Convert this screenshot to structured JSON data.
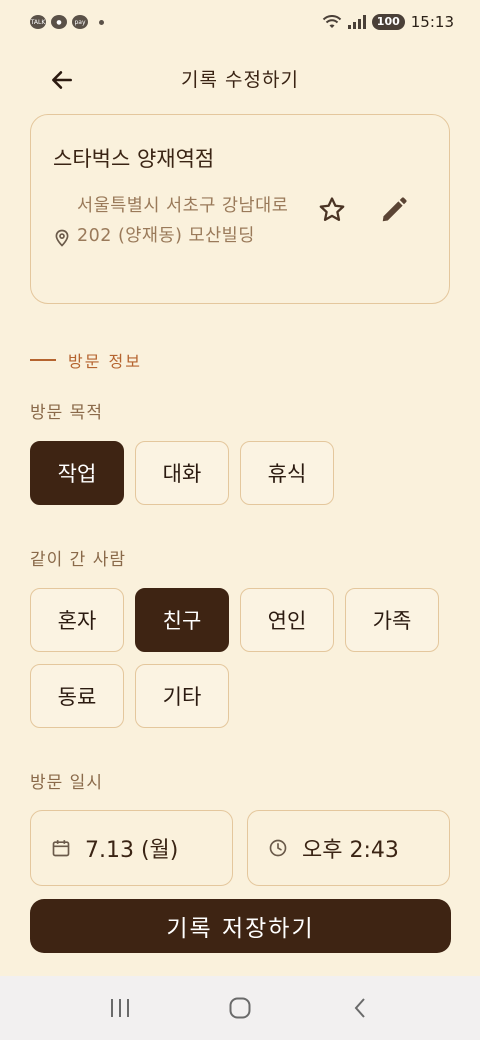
{
  "status_bar": {
    "app_badges": [
      "TALK",
      "pay"
    ],
    "battery": "100",
    "time": "15:13"
  },
  "app_bar": {
    "title": "기록 수정하기",
    "back_icon": "arrow-left-icon"
  },
  "place": {
    "name": "스타벅스 양재역점",
    "address": "서울특별시 서초구 강남대로 202 (양재동) 모산빌딩",
    "pin_icon": "map-pin-icon",
    "favorite_icon": "star-outline-icon",
    "edit_icon": "pencil-icon"
  },
  "section": {
    "title": "방문 정보"
  },
  "purpose": {
    "label": "방문 목적",
    "options": [
      "작업",
      "대화",
      "휴식"
    ],
    "selected": "작업"
  },
  "companion": {
    "label": "같이 간 사람",
    "options": [
      "혼자",
      "친구",
      "연인",
      "가족",
      "동료",
      "기타"
    ],
    "selected": "친구"
  },
  "datetime": {
    "label": "방문 일시",
    "date": "7.13 (월)",
    "time": "오후 2:43",
    "date_icon": "calendar-icon",
    "time_icon": "clock-icon"
  },
  "save_button": {
    "label": "기록 저장하기"
  },
  "colors": {
    "background": "#faf1dc",
    "accent_dark": "#3e2413",
    "accent_orange": "#b5642f",
    "border": "#e4c79d",
    "muted_text": "#9a7a5a"
  }
}
